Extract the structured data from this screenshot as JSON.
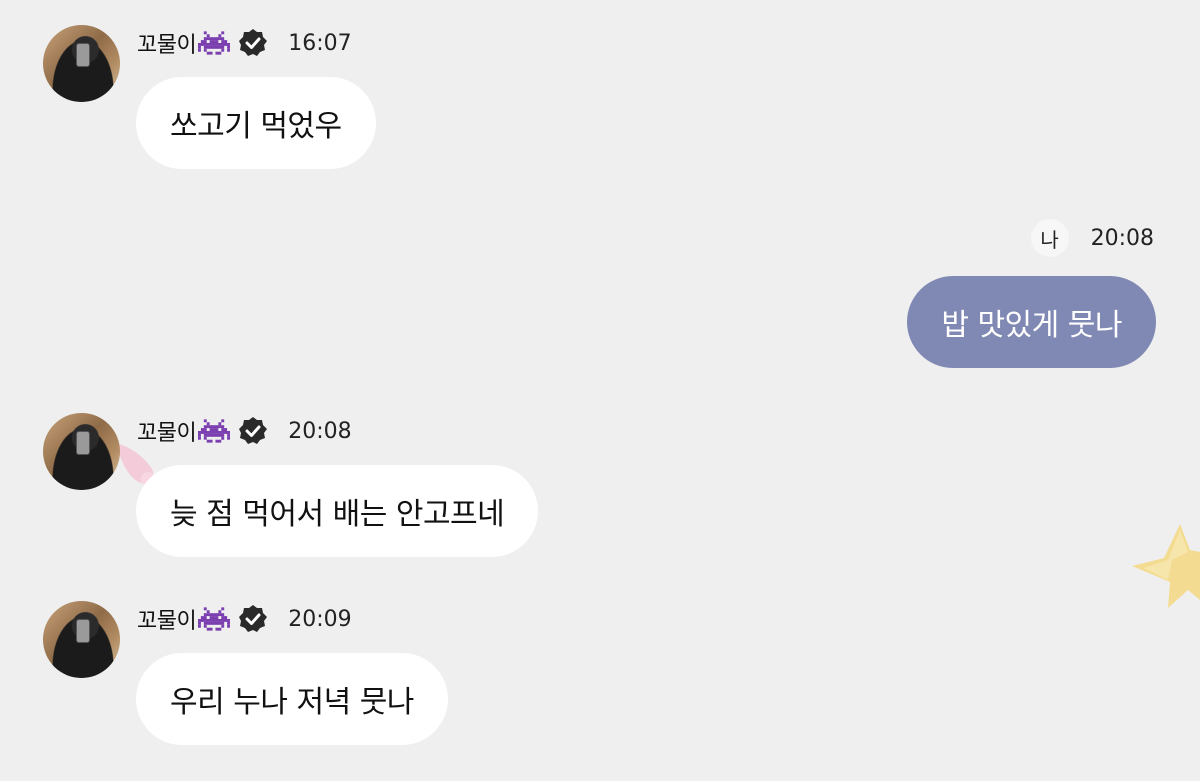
{
  "sender": {
    "name": "꼬물이",
    "me_label": "나"
  },
  "messages": [
    {
      "time": "16:07",
      "text": "쏘고기 먹었우"
    },
    {
      "time": "20:08",
      "text": "밥 맛있게 뭇나"
    },
    {
      "time": "20:08",
      "text": "늦 점 먹어서 배는 안고프네"
    },
    {
      "time": "20:09",
      "text": "우리 누나 저녁 뭇나"
    }
  ],
  "colors": {
    "background": "#efefef",
    "me_bubble": "#8088b4",
    "other_bubble": "#ffffff"
  },
  "icons": [
    "alien-monster-emoji",
    "verified-check-icon",
    "star-sticker",
    "pink-sticker"
  ]
}
